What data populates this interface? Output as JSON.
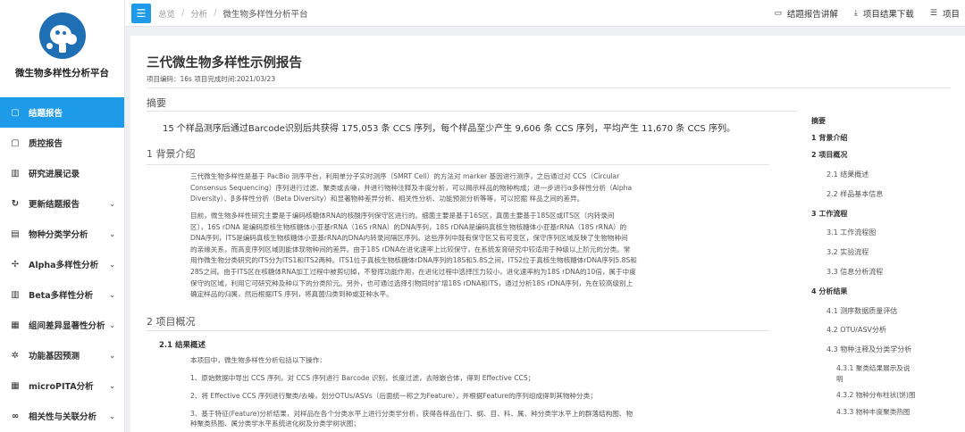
{
  "sidebar": {
    "brand": "微生物多样性分析平台",
    "items": [
      {
        "label": "结题报告",
        "icon": "document-icon",
        "glyph": "▢",
        "active": true,
        "chevron": false
      },
      {
        "label": "质控报告",
        "icon": "document-icon",
        "glyph": "▢",
        "active": false,
        "chevron": false
      },
      {
        "label": "研究进展记录",
        "icon": "bar-chart-icon",
        "glyph": "▥",
        "active": false,
        "chevron": false
      },
      {
        "label": "更新结题报告",
        "icon": "refresh-icon",
        "glyph": "↻",
        "active": false,
        "chevron": true
      },
      {
        "label": "物种分类学分析",
        "icon": "list-icon",
        "glyph": "▤",
        "active": false,
        "chevron": true
      },
      {
        "label": "Alpha多样性分析",
        "icon": "crosshair-icon",
        "glyph": "✢",
        "active": false,
        "chevron": true
      },
      {
        "label": "Beta多样性分析",
        "icon": "bar-chart-icon",
        "glyph": "▥",
        "active": false,
        "chevron": true
      },
      {
        "label": "组间差异显著性分析",
        "icon": "table-icon",
        "glyph": "▦",
        "active": false,
        "chevron": true
      },
      {
        "label": "功能基因预测",
        "icon": "gear-icon",
        "glyph": "✲",
        "active": false,
        "chevron": true
      },
      {
        "label": "microPITA分析",
        "icon": "grid-icon",
        "glyph": "▦",
        "active": false,
        "chevron": true
      },
      {
        "label": "相关性与关联分析",
        "icon": "link-icon",
        "glyph": "∞",
        "active": false,
        "chevron": true
      }
    ],
    "chevron_glyph": "⌄"
  },
  "topbar": {
    "menu_glyph": "☰",
    "breadcrumb": [
      "总览",
      "分析",
      "微生物多样性分析平台"
    ],
    "crumb_sep": "/",
    "actions": [
      {
        "label": "结题报告讲解",
        "icon": "video-icon",
        "glyph": "▭"
      },
      {
        "label": "项目结果下载",
        "icon": "download-icon",
        "glyph": "⤓"
      },
      {
        "label": "项目",
        "icon": "list-icon",
        "glyph": "☰"
      }
    ]
  },
  "report": {
    "title": "三代微生物多样性示例报告",
    "meta": "项目编码：16s  项目完成时间:2021/03/23",
    "abstract_heading": "摘要",
    "summary": "15 个样品测序后通过Barcode识别后共获得 175,053 条 CCS 序列，每个样品至少产生 9,606 条 CCS 序列，平均产生 11,670 条 CCS 序列。",
    "section1_heading": "1 背景介绍",
    "para1": [
      "三代微生物多样性是基于 PacBio 测序平台，利用单分子实时测序（SMRT Cell）的方法对 marker 基因进行测序，之后通过对 CCS（Circular",
      "Consensus Sequencing）序列进行过滤、聚类或去噪，并进行物种注释及丰度分析，可以揭示样品的物种构成；进一步进行α多样性分析（Alpha",
      "Diversity）、β多样性分析（Beta Diversity）和显著物种差异分析、相关性分析、功能预测分析等等，可以挖掘 样品之间的差异。"
    ],
    "para2": [
      "目前，微生物多样性研究主要是于编码核糖体RNA的核酸序列保守区进行的。细菌主要是基于16S区，真菌主要基于18S区或ITS区（内转录间",
      "区），16S rDNA 是编码原核生物核糖体小亚基rRNA（16S rRNA）的DNA序列，18S rDNA是编码真核生物核糖体小亚基rRNA（18S rRNA）的",
      "DNA序列，ITS是编码真核生物核糖体小亚基rRNA的DNA内转录间隔区序列。这些序列中既有保守区又有可变区，保守序列区域反映了生物物种间",
      "的亲缘关系，而高变序列区域则能体现物种间的差异。由于18S rDNA在进化速率上比较保守，在系统发育研究中较适用于种级以上阶元的分类。常",
      "用作微生物分类研究的ITS分为ITS1和ITS2两种。ITS1位于真核生物核糖体rDNA序列的18S和5.8S之间，ITS2位于真核生物核糖体rDNA序列5.8S和",
      "28S之间。由于ITS区在核糖体RNA加工过程中被剪切掉，不發挥功能作用，在进化过程中选择压力较小，进化速率約为18S rDNA的10倍，属于中度",
      "保守的区域，利用它可研究种及种以下的分类阶元。另外，也可通过选择引物同时扩增18S rDNA和ITS，通过分析18S rDNA序列，先在较高级别上",
      "确定样品的归属，然后根据ITS 序列，将真菌归类到种或亚种水平。"
    ],
    "section2_heading": "2 项目概况",
    "sub21_heading": "2.1 结果概述",
    "para3": [
      "本项目中，微生物多样性分析包括以下操作：",
      "1、原始数据中导出 CCS 序列，对 CCS 序列进行 Barcode 识别，长度过滤，去除嵌合体，得到 Effective CCS；",
      "2、将 Effective CCS 序列进行聚类/去噪，划分OTUs/ASVs（后面统一称之为Feature），并根据Feature的序列组成得到其物种分类；",
      "3、基于特征(Feature)分析结果，对样品在各个分类水平上进行分类学分析，获得各样品在门、纲、目、科、属、种分类学水平上的群落结构图、物",
      "种聚类热图、属分类学水平系统进化树及分类学树状图；"
    ]
  },
  "toc": {
    "items": [
      {
        "label": "摘要",
        "level": 1
      },
      {
        "label": "1 背景介绍",
        "level": 1
      },
      {
        "label": "2 项目概况",
        "level": 1
      },
      {
        "label": "2.1 结果概述",
        "level": 2
      },
      {
        "label": "2.2 样品基本信息",
        "level": 2
      },
      {
        "label": "3 工作流程",
        "level": 1
      },
      {
        "label": "3.1 工作流程图",
        "level": 2
      },
      {
        "label": "3.2 实验流程",
        "level": 2
      },
      {
        "label": "3.3 信息分析流程",
        "level": 2
      },
      {
        "label": "4 分析结果",
        "level": 1
      },
      {
        "label": "4.1 测序数据质量评估",
        "level": 2
      },
      {
        "label": "4.2 OTU/ASV分析",
        "level": 2
      },
      {
        "label": "4.3 物种注释及分类学分析",
        "level": 2
      },
      {
        "label": "4.3.1 聚类结果展示及说",
        "level": 3
      },
      {
        "label": "明",
        "level": 3
      },
      {
        "label": "4.3.2 物种分布柱状(饼)图",
        "level": 3
      },
      {
        "label": "4.3.3 物种丰度聚类热图",
        "level": 3
      }
    ]
  }
}
